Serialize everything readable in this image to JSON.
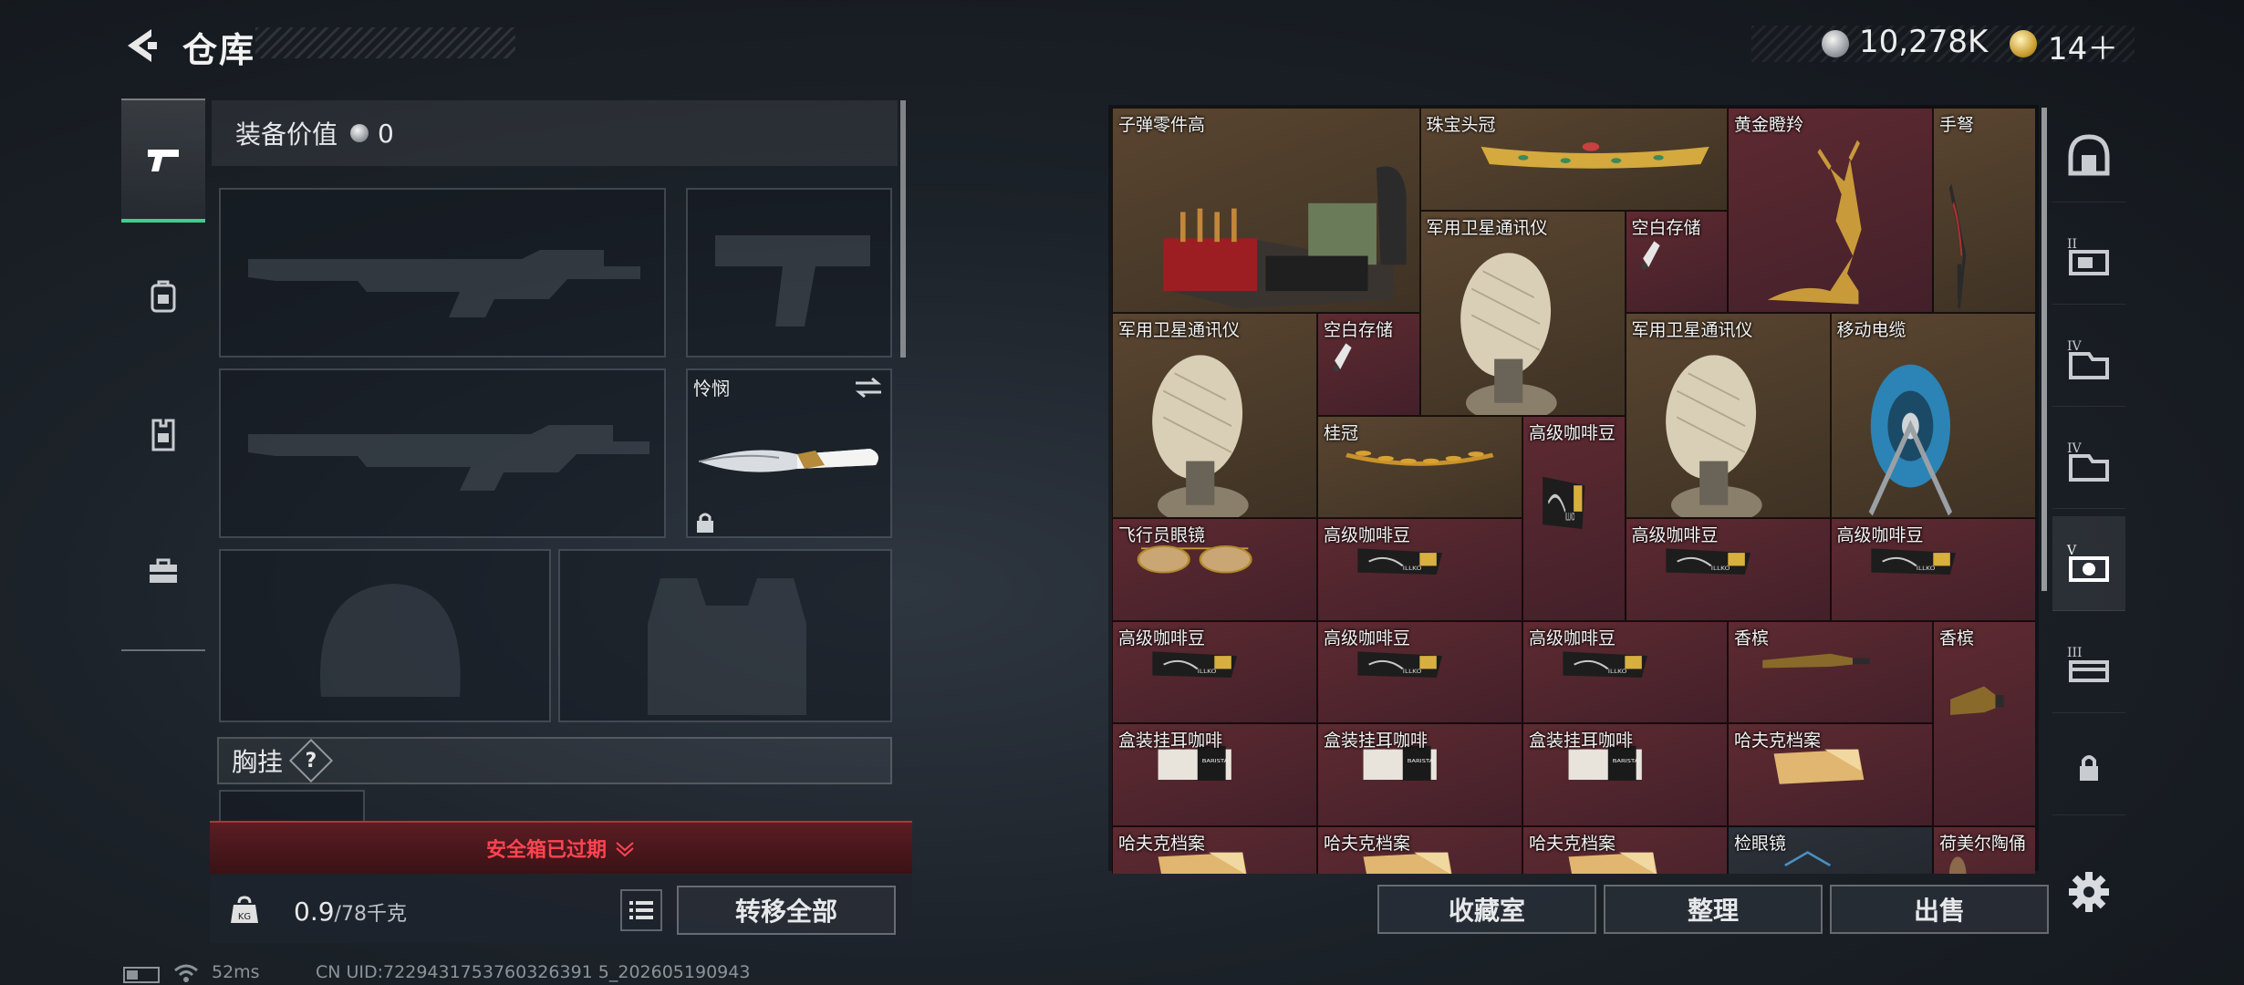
{
  "header": {
    "title": "仓库",
    "currency_silver": "10,278K",
    "currency_gold": "14＋"
  },
  "categories": [
    "pistol-icon",
    "backpack-icon",
    "vest-icon",
    "toolbox-icon"
  ],
  "equipment": {
    "value_label": "装备价值",
    "value": "0",
    "melee_name": "怜悯",
    "chest_label": "胸挂",
    "help": "?"
  },
  "safe_box": {
    "status": "安全箱已过期"
  },
  "bottom_left": {
    "weight_value": "0.9",
    "weight_cap": "/78千克",
    "transfer_all": "转移全部"
  },
  "stash_items": [
    {
      "name": "子弹零件高",
      "rarity": "brown",
      "icon": "ammo-parts-icon"
    },
    {
      "name": "珠宝头冠",
      "rarity": "brown",
      "icon": "jewel-crown-icon"
    },
    {
      "name": "黄金瞪羚",
      "rarity": "red",
      "icon": "golden-gazelle-icon"
    },
    {
      "name": "手弩",
      "rarity": "brown",
      "icon": "hand-crossbow-icon"
    },
    {
      "name": "军用卫星通讯仪",
      "rarity": "brown",
      "icon": "satellite-comm-icon"
    },
    {
      "name": "空白存储",
      "rarity": "red",
      "icon": "blank-storage-icon"
    },
    {
      "name": "军用卫星通讯仪",
      "rarity": "brown",
      "icon": "satellite-comm-icon"
    },
    {
      "name": "空白存储",
      "rarity": "red",
      "icon": "blank-storage-icon"
    },
    {
      "name": "军用卫星通讯仪",
      "rarity": "brown",
      "icon": "satellite-comm-icon"
    },
    {
      "name": "移动电缆",
      "rarity": "brown",
      "icon": "cable-reel-icon"
    },
    {
      "name": "桂冠",
      "rarity": "brown",
      "icon": "laurel-crown-icon"
    },
    {
      "name": "高级咖啡豆",
      "rarity": "red",
      "icon": "coffee-beans-icon"
    },
    {
      "name": "飞行员眼镜",
      "rarity": "red",
      "icon": "aviator-glasses-icon"
    },
    {
      "name": "高级咖啡豆",
      "rarity": "red",
      "icon": "coffee-beans-icon"
    },
    {
      "name": "高级咖啡豆",
      "rarity": "red",
      "icon": "coffee-beans-icon"
    },
    {
      "name": "高级咖啡豆",
      "rarity": "red",
      "icon": "coffee-beans-icon"
    },
    {
      "name": "高级咖啡豆",
      "rarity": "red",
      "icon": "coffee-beans-icon"
    },
    {
      "name": "高级咖啡豆",
      "rarity": "red",
      "icon": "coffee-beans-icon"
    },
    {
      "name": "高级咖啡豆",
      "rarity": "red",
      "icon": "coffee-beans-icon"
    },
    {
      "name": "香槟",
      "rarity": "red",
      "icon": "champagne-icon"
    },
    {
      "name": "香槟",
      "rarity": "red",
      "icon": "champagne-icon"
    },
    {
      "name": "盒装挂耳咖啡",
      "rarity": "red",
      "icon": "boxed-coffee-icon"
    },
    {
      "name": "盒装挂耳咖啡",
      "rarity": "red",
      "icon": "boxed-coffee-icon"
    },
    {
      "name": "盒装挂耳咖啡",
      "rarity": "red",
      "icon": "boxed-coffee-icon"
    },
    {
      "name": "哈夫克档案",
      "rarity": "red",
      "icon": "haavk-file-icon"
    },
    {
      "name": "哈夫克档案",
      "rarity": "red",
      "icon": "haavk-file-icon"
    },
    {
      "name": "哈夫克档案",
      "rarity": "red",
      "icon": "haavk-file-icon"
    },
    {
      "name": "哈夫克档案",
      "rarity": "red",
      "icon": "haavk-file-icon"
    },
    {
      "name": "检眼镜",
      "rarity": "dark",
      "icon": "ophthalmoscope-icon"
    },
    {
      "name": "荷美尔陶俑",
      "rarity": "red",
      "icon": "pottery-figure-icon"
    }
  ],
  "right_tabs": [
    "vault-icon",
    "stash-II-icon",
    "stash-IV-icon",
    "stash-IV-icon",
    "stash-V-icon",
    "stash-III-icon",
    "lock-icon"
  ],
  "actions": {
    "vault": "收藏室",
    "sort": "整理",
    "sell": "出售"
  },
  "footer": {
    "ping": "52ms",
    "uid": "CN UID:7229431753760326391 5_202605190943"
  },
  "colors": {
    "rarity_red": "#5e2a31",
    "rarity_brown": "#5a4530",
    "safe_warning": "#ff4451",
    "active_tab": "#3ecf8e"
  }
}
